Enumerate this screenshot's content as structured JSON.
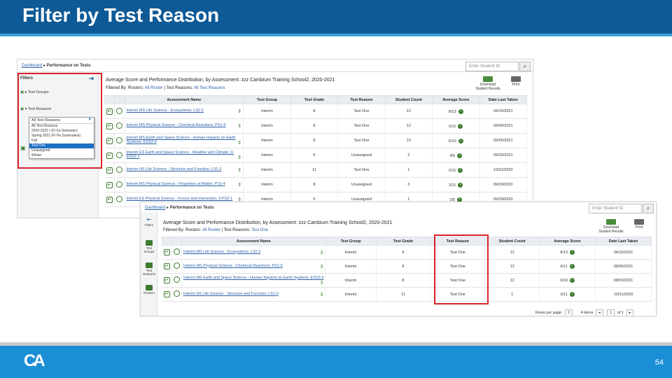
{
  "slide": {
    "title": "Filter by Test Reason",
    "page_number": "54",
    "logo": "CA"
  },
  "shot1": {
    "breadcrumb": {
      "home": "Dashboard",
      "current": "Performance on Tests"
    },
    "search_placeholder": "Enter Student ID",
    "heading": "Average Score and Performance Distribution, by Assessment: zzz Cambium Training School2, 2020-2021",
    "filter_rosters_label": "Filtered By: Rosters:",
    "filter_rosters_value": "All Roster",
    "filter_reasons_label": "Test Reasons:",
    "filter_reasons_value": "All Test Reasons",
    "download_label": "Download Student Results",
    "print_label": "Print",
    "filters": {
      "title": "Filters",
      "test_group": "Test Groups",
      "test_reasons": "Test Reasons",
      "dropdown_selected": "All Test Reasons",
      "options": [
        "All Test Reasons",
        "2020-2021 I (FI Fa Semester)",
        "Spring 2021 (FI Pa Summative)",
        "Fall",
        "Test One",
        "Unassigned",
        "Winter"
      ],
      "highlighted": "Test One"
    },
    "columns": [
      "Assessment Name",
      "Test Group",
      "Test Grade",
      "Test Reason",
      "Student Count",
      "Average Score",
      "Date Last Taken"
    ],
    "rows": [
      [
        "Interim MS Life Science - Ecosystems: LS2-2",
        "Interim",
        "8",
        "Test One",
        "12",
        "8/13",
        "04/15/2021"
      ],
      [
        "Interim MS Physical Science - Chemical Reactions: PS1-6",
        "Interim",
        "8",
        "Test One",
        "12",
        "6/11",
        "09/06/2021"
      ],
      [
        "Interim MS Earth and Space Science - Human Impacts on Earth Systems: ESS3-3",
        "Interim",
        "8",
        "Test One",
        "12",
        "6/10",
        "09/06/2021"
      ],
      [
        "Interim ES Earth and Space Science - Weather and Climate: 3-ESS2-1",
        "Interim",
        "5",
        "Unassigned",
        "2",
        "4/5",
        "09/25/2021"
      ],
      [
        "Interim HS Life Science - Structure and Function: LS1-3",
        "Interim",
        "11",
        "Test One",
        "1",
        "0/11",
        "10/31/2020"
      ],
      [
        "Interim MS Physical Science - Properties of Matter: PS1-4",
        "Interim",
        "8",
        "Unassigned",
        "3",
        "3/11",
        "09/29/2020"
      ],
      [
        "Interim ES Physical Science - Forces and Interaction: 3-PS2-1",
        "Interim",
        "5",
        "Unassigned",
        "1",
        "2/5",
        "09/30/2020"
      ]
    ]
  },
  "shot2": {
    "breadcrumb": {
      "home": "Dashboard",
      "current": "Performance on Tests"
    },
    "search_placeholder": "Enter Student ID",
    "heading": "Average Score and Performance Distribution, by Assessment: zzz Cambium Training School2, 2020-2021",
    "filter_rosters_label": "Filtered By: Rosters:",
    "filter_rosters_value": "All Roster",
    "filter_reasons_label": "Test Reasons:",
    "filter_reasons_value": "Test One",
    "download_label": "Download Student Results",
    "print_label": "Print",
    "rail": [
      "Filters",
      "Test Groups",
      "Test Reasons",
      "Rosters"
    ],
    "columns": [
      "Assessment Name",
      "Test Group",
      "Test Grade",
      "Test Reason",
      "Student Count",
      "Average Score",
      "Date Last Taken"
    ],
    "rows": [
      [
        "Interim MS Life Science - Ecosystems: LS2-2",
        "Interim",
        "8",
        "Test One",
        "12",
        "8/13",
        "04/15/2021"
      ],
      [
        "Interim MS Physical Science - Chemical Reactions: PS1-6",
        "Interim",
        "8",
        "Test One",
        "12",
        "6/11",
        "09/06/2021"
      ],
      [
        "Interim MS Earth and Space Science - Human Impacts on Earth Systems: ESS3-3",
        "Interim",
        "8",
        "Test One",
        "12",
        "6/10",
        "08/03/2021"
      ],
      [
        "Interim HS Life Science - Structure and Function: LS1-3",
        "Interim",
        "11",
        "Test One",
        "1",
        "0/11",
        "10/31/2020"
      ]
    ],
    "pager": {
      "rows_label": "Rows per page:",
      "rows_value": "2",
      "items": "4 items",
      "page": "1",
      "of": "of 1"
    }
  },
  "colors": {
    "header": "#0e5a96",
    "footer": "#1b8fd6",
    "highlight": "#d9232a",
    "icon_green": "#3d7c2f"
  }
}
